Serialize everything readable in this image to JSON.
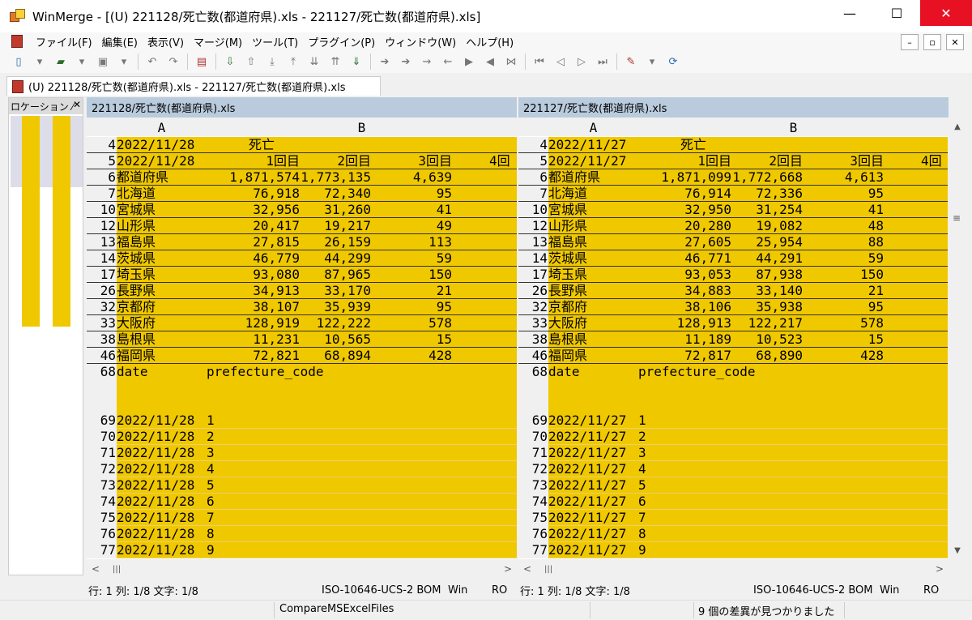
{
  "window": {
    "title": "WinMerge - [(U) 221128/死亡数(都道府県).xls - 221127/死亡数(都道府県).xls]",
    "controls": {
      "minimize": "—",
      "maximize": "☐",
      "close": "✕"
    }
  },
  "menu": {
    "items": [
      "ファイル(F)",
      "編集(E)",
      "表示(V)",
      "マージ(M)",
      "ツール(T)",
      "プラグイン(P)",
      "ウィンドウ(W)",
      "ヘルプ(H)"
    ]
  },
  "mdi": {
    "minimize": "–",
    "restore": "▫",
    "close": "✕"
  },
  "tab": {
    "label": "(U) 221128/死亡数(都道府県).xls - 221127/死亡数(都道府県).xls"
  },
  "location_pane": {
    "title": "ロケーション ⁄",
    "close": "✕"
  },
  "left": {
    "path": "221128/死亡数(都道府県).xls",
    "col_a": "A",
    "col_b": "B",
    "rows": [
      {
        "n": "4",
        "a": "2022/11/28",
        "b1": "死亡",
        "b2": "",
        "b3": "",
        "b4": ""
      },
      {
        "n": "5",
        "a": "2022/11/28",
        "b1": "1回目",
        "b2": "2回目",
        "b3": "3回目",
        "b4": "4回"
      },
      {
        "n": "6",
        "a": "都道府県",
        "b1": "1,871,574",
        "b2": "1,773,135",
        "b3": "4,639",
        "b4": ""
      },
      {
        "n": "7",
        "a": "北海道",
        "b1": "76,918",
        "b2": "72,340",
        "b3": "95",
        "b4": ""
      },
      {
        "n": "10",
        "a": "宮城県",
        "b1": "32,956",
        "b2": "31,260",
        "b3": "41",
        "b4": ""
      },
      {
        "n": "12",
        "a": "山形県",
        "b1": "20,417",
        "b2": "19,217",
        "b3": "49",
        "b4": ""
      },
      {
        "n": "13",
        "a": "福島県",
        "b1": "27,815",
        "b2": "26,159",
        "b3": "113",
        "b4": ""
      },
      {
        "n": "14",
        "a": "茨城県",
        "b1": "46,779",
        "b2": "44,299",
        "b3": "59",
        "b4": ""
      },
      {
        "n": "17",
        "a": "埼玉県",
        "b1": "93,080",
        "b2": "87,965",
        "b3": "150",
        "b4": ""
      },
      {
        "n": "26",
        "a": "長野県",
        "b1": "34,913",
        "b2": "33,170",
        "b3": "21",
        "b4": ""
      },
      {
        "n": "32",
        "a": "京都府",
        "b1": "38,107",
        "b2": "35,939",
        "b3": "95",
        "b4": ""
      },
      {
        "n": "33",
        "a": "大阪府",
        "b1": "128,919",
        "b2": "122,222",
        "b3": "578",
        "b4": ""
      },
      {
        "n": "38",
        "a": "島根県",
        "b1": "11,231",
        "b2": "10,565",
        "b3": "15",
        "b4": ""
      },
      {
        "n": "46",
        "a": "福岡県",
        "b1": "72,821",
        "b2": "68,894",
        "b3": "428",
        "b4": ""
      }
    ],
    "header_row": {
      "n": "68",
      "a": "date",
      "b": "prefecture_code"
    },
    "data_rows": [
      {
        "n": "69",
        "a": "2022/11/28",
        "b": "1"
      },
      {
        "n": "70",
        "a": "2022/11/28",
        "b": "2"
      },
      {
        "n": "71",
        "a": "2022/11/28",
        "b": "3"
      },
      {
        "n": "72",
        "a": "2022/11/28",
        "b": "4"
      },
      {
        "n": "73",
        "a": "2022/11/28",
        "b": "5"
      },
      {
        "n": "74",
        "a": "2022/11/28",
        "b": "6"
      },
      {
        "n": "75",
        "a": "2022/11/28",
        "b": "7"
      },
      {
        "n": "76",
        "a": "2022/11/28",
        "b": "8"
      },
      {
        "n": "77",
        "a": "2022/11/28",
        "b": "9"
      }
    ],
    "status": {
      "pos": "行: 1  列: 1/8  文字: 1/8",
      "enc": "ISO-10646-UCS-2 BOM",
      "eol": "Win",
      "ro": "RO"
    }
  },
  "right": {
    "path": "221127/死亡数(都道府県).xls",
    "col_a": "A",
    "col_b": "B",
    "rows": [
      {
        "n": "4",
        "a": "2022/11/27",
        "b1": "死亡",
        "b2": "",
        "b3": "",
        "b4": ""
      },
      {
        "n": "5",
        "a": "2022/11/27",
        "b1": "1回目",
        "b2": "2回目",
        "b3": "3回目",
        "b4": "4回"
      },
      {
        "n": "6",
        "a": "都道府県",
        "b1": "1,871,099",
        "b2": "1,772,668",
        "b3": "4,613",
        "b4": ""
      },
      {
        "n": "7",
        "a": "北海道",
        "b1": "76,914",
        "b2": "72,336",
        "b3": "95",
        "b4": ""
      },
      {
        "n": "10",
        "a": "宮城県",
        "b1": "32,950",
        "b2": "31,254",
        "b3": "41",
        "b4": ""
      },
      {
        "n": "12",
        "a": "山形県",
        "b1": "20,280",
        "b2": "19,082",
        "b3": "48",
        "b4": ""
      },
      {
        "n": "13",
        "a": "福島県",
        "b1": "27,605",
        "b2": "25,954",
        "b3": "88",
        "b4": ""
      },
      {
        "n": "14",
        "a": "茨城県",
        "b1": "46,771",
        "b2": "44,291",
        "b3": "59",
        "b4": ""
      },
      {
        "n": "17",
        "a": "埼玉県",
        "b1": "93,053",
        "b2": "87,938",
        "b3": "150",
        "b4": ""
      },
      {
        "n": "26",
        "a": "長野県",
        "b1": "34,883",
        "b2": "33,140",
        "b3": "21",
        "b4": ""
      },
      {
        "n": "32",
        "a": "京都府",
        "b1": "38,106",
        "b2": "35,938",
        "b3": "95",
        "b4": ""
      },
      {
        "n": "33",
        "a": "大阪府",
        "b1": "128,913",
        "b2": "122,217",
        "b3": "578",
        "b4": ""
      },
      {
        "n": "38",
        "a": "島根県",
        "b1": "11,189",
        "b2": "10,523",
        "b3": "15",
        "b4": ""
      },
      {
        "n": "46",
        "a": "福岡県",
        "b1": "72,817",
        "b2": "68,890",
        "b3": "428",
        "b4": ""
      }
    ],
    "header_row": {
      "n": "68",
      "a": "date",
      "b": "prefecture_code"
    },
    "data_rows": [
      {
        "n": "69",
        "a": "2022/11/27",
        "b": "1"
      },
      {
        "n": "70",
        "a": "2022/11/27",
        "b": "2"
      },
      {
        "n": "71",
        "a": "2022/11/27",
        "b": "3"
      },
      {
        "n": "72",
        "a": "2022/11/27",
        "b": "4"
      },
      {
        "n": "73",
        "a": "2022/11/27",
        "b": "5"
      },
      {
        "n": "74",
        "a": "2022/11/27",
        "b": "6"
      },
      {
        "n": "75",
        "a": "2022/11/27",
        "b": "7"
      },
      {
        "n": "76",
        "a": "2022/11/27",
        "b": "8"
      },
      {
        "n": "77",
        "a": "2022/11/27",
        "b": "9"
      }
    ],
    "status": {
      "pos": "行: 1  列: 1/8  文字: 1/8",
      "enc": "ISO-10646-UCS-2 BOM",
      "eol": "Win",
      "ro": "RO"
    }
  },
  "statusbar": {
    "plugin": "CompareMSExcelFiles",
    "diffs": "9 個の差異が見つかりました"
  },
  "colors": {
    "diff_yellow": "#f0c800",
    "pane_header": "#b9cbdd",
    "close_red": "#e81123"
  }
}
